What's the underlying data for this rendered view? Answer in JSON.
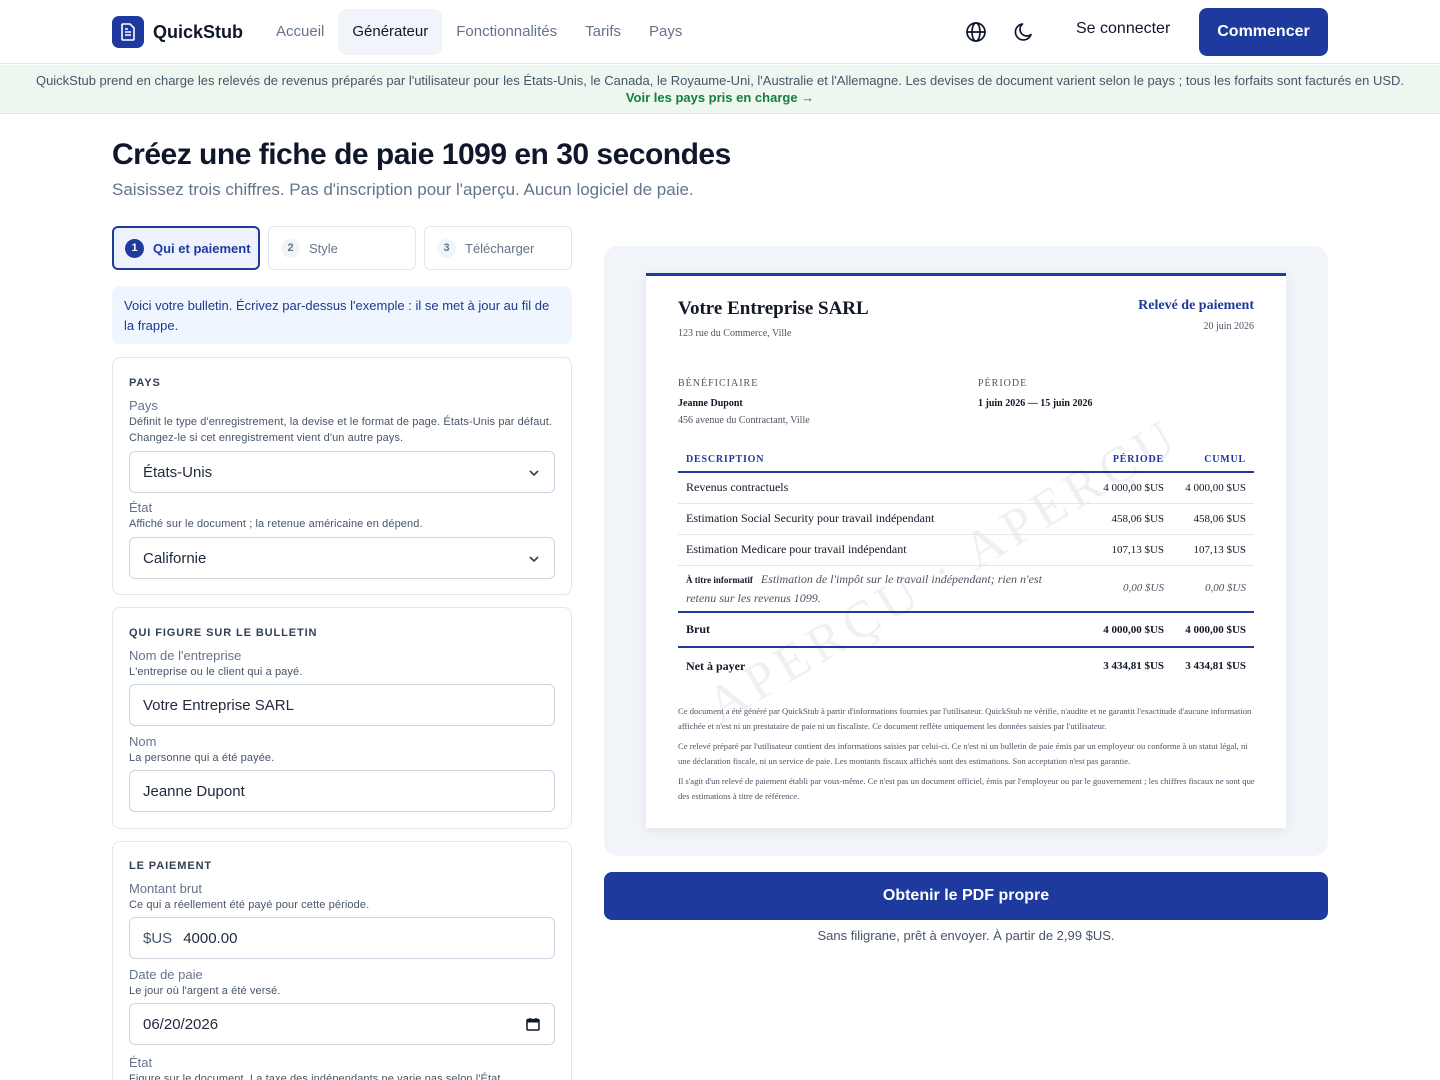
{
  "nav": {
    "brand": "QuickStub",
    "links": [
      "Accueil",
      "Générateur",
      "Fonctionnalités",
      "Tarifs",
      "Pays"
    ],
    "active_link": "Générateur",
    "icons": [
      "globe-icon",
      "moon-icon"
    ],
    "login": "Se connecter",
    "cta": "Commencer"
  },
  "banner": {
    "text": "QuickStub prend en charge les relevés de revenus préparés par l'utilisateur pour les États-Unis, le Canada, le Royaume-Uni, l'Australie et l'Allemagne. Les devises de document varient selon le pays ; tous les forfaits sont facturés en USD.",
    "link": "Voir les pays pris en charge →"
  },
  "hero": {
    "title": "Créez une fiche de paie 1099 en 30 secondes",
    "subtitle": "Saisissez trois chiffres. Pas d'inscription pour l'aperçu. Aucun logiciel de paie."
  },
  "steps": [
    {
      "num": "1",
      "label": "Qui et paiement",
      "active": true
    },
    {
      "num": "2",
      "label": "Style",
      "active": false
    },
    {
      "num": "3",
      "label": "Télécharger",
      "active": false
    }
  ],
  "info": "Voici votre bulletin. Écrivez par-dessus l'exemple : il se met à jour au fil de la frappe.",
  "country_section": {
    "title": "PAYS",
    "country_label": "Pays",
    "country_help": "Définit le type d'enregistrement, la devise et le format de page. États-Unis par défaut. Changez-le si cet enregistrement vient d'un autre pays.",
    "country_value": "États-Unis",
    "state_label": "État",
    "state_help": "Affiché sur le document ; la retenue américaine en dépend.",
    "state_value": "Californie"
  },
  "who_section": {
    "title": "QUI FIGURE SUR LE BULLETIN",
    "company_label": "Nom de l'entreprise",
    "company_help": "L'entreprise ou le client qui a payé.",
    "company_value": "Votre Entreprise SARL",
    "name_label": "Nom",
    "name_help": "La personne qui a été payée.",
    "name_value": "Jeanne Dupont"
  },
  "payment_section": {
    "title": "LE PAIEMENT",
    "gross_label": "Montant brut",
    "gross_help": "Ce qui a réellement été payé pour cette période.",
    "gross_prefix": "$US",
    "gross_value": "4000.00",
    "date_label": "Date de paie",
    "date_help": "Le jour où l'argent a été versé.",
    "date_value": "06/20/2026",
    "state_label": "État",
    "state_help": "Figure sur le document. La taxe des indépendants ne varie pas selon l'État."
  },
  "document": {
    "company": "Votre Entreprise SARL",
    "company_address": "123 rue du Commerce, Ville",
    "title": "Relevé de paiement",
    "date": "20 juin 2026",
    "payee_caption": "BÉNÉFICIAIRE",
    "payee_name": "Jeanne Dupont",
    "payee_address": "456 avenue du Contractant, Ville",
    "period_caption": "PÉRIODE",
    "period": "1 juin 2026 — 15 juin 2026",
    "columns": [
      "DESCRIPTION",
      "PÉRIODE",
      "CUMUL"
    ],
    "rows": [
      {
        "desc": "Revenus contractuels",
        "period": "4 000,00 $US",
        "ytd": "4 000,00 $US"
      },
      {
        "desc": "Estimation Social Security pour travail indépendant",
        "period": "458,06 $US",
        "ytd": "458,06 $US"
      },
      {
        "desc": "Estimation Medicare pour travail indépendant",
        "period": "107,13 $US",
        "ytd": "107,13 $US"
      }
    ],
    "info_row": {
      "tag": "À titre informatif",
      "desc": "Estimation de l'impôt sur le travail indépendant; rien n'est retenu sur les revenus 1099.",
      "period": "0,00 $US",
      "ytd": "0,00 $US"
    },
    "gross": {
      "label": "Brut",
      "period": "4 000,00 $US",
      "ytd": "4 000,00 $US"
    },
    "net": {
      "label": "Net à payer",
      "period": "3 434,81 $US",
      "ytd": "3 434,81 $US"
    },
    "disclaimers": [
      "Ce document a été généré par QuickStub à partir d'informations fournies par l'utilisateur. QuickStub ne vérifie, n'audite et ne garantit l'exactitude d'aucune information affichée et n'est ni un prestataire de paie ni un fiscaliste. Ce document reflète uniquement les données saisies par l'utilisateur.",
      "Ce relevé préparé par l'utilisateur contient des informations saisies par celui-ci. Ce n'est ni un bulletin de paie émis par un employeur ou conforme à un statut légal, ni une déclaration fiscale, ni un service de paie. Les montants fiscaux affichés sont des estimations. Son acceptation n'est pas garantie.",
      "Il s'agit d'un relevé de paiement établi par vous-même. Ce n'est pas un document officiel, émis par l'employeur ou par le gouvernement ; les chiffres fiscaux ne sont que des estimations à titre de référence."
    ],
    "watermark": "APERÇU · APERÇU"
  },
  "pdf": {
    "button": "Obtenir le PDF propre",
    "note": "Sans filigrane, prêt à envoyer. À partir de 2,99 $US."
  },
  "colors": {
    "primary": "#1e3a9f",
    "banner_bg": "#eef6f0",
    "banner_link": "#15803d",
    "preview_bg": "#f1f5f9"
  }
}
